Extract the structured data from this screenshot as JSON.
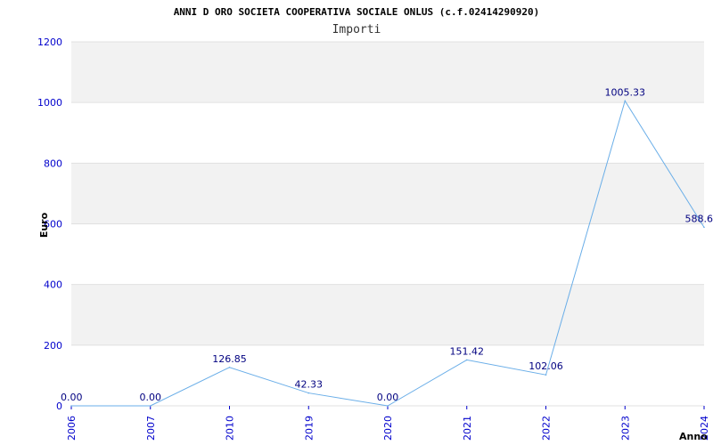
{
  "chart_data": {
    "type": "line",
    "title": "ANNI D ORO SOCIETA COOPERATIVA SOCIALE ONLUS (c.f.02414290920)",
    "subtitle": "Importi",
    "xlabel": "Anno",
    "ylabel": "Euro",
    "categories": [
      "2006",
      "2007",
      "2010",
      "2019",
      "2020",
      "2021",
      "2022",
      "2023",
      "2024"
    ],
    "values": [
      0.0,
      0.0,
      126.85,
      42.33,
      0.0,
      151.42,
      102.06,
      1005.33,
      588.6
    ],
    "value_labels": [
      "0.00",
      "0.00",
      "126.85",
      "42.33",
      "0.00",
      "151.42",
      "102.06",
      "1005.33",
      "588.6"
    ],
    "ylim": [
      0,
      1200
    ],
    "yticks": [
      "0",
      "200",
      "400",
      "600",
      "800",
      "1000",
      "1200"
    ],
    "grid": true,
    "band_colors": [
      "#f2f2f2",
      "#ffffff"
    ],
    "line_color": "#6aaee8",
    "tick_color": "#0000cc",
    "label_color": "#000080"
  }
}
